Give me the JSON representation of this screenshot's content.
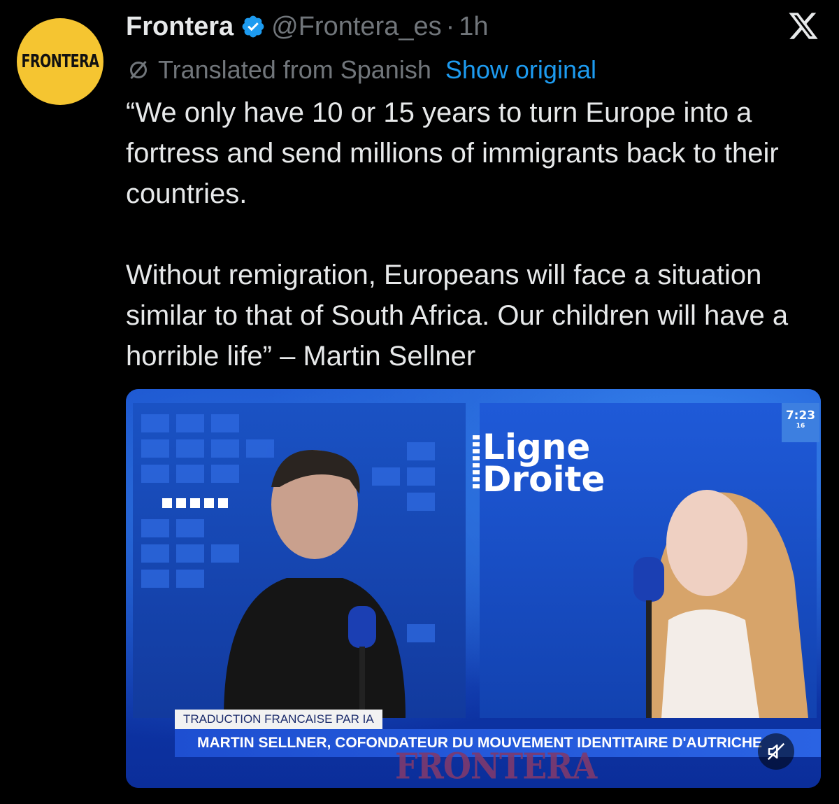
{
  "account": {
    "avatar_text": "FRONTERA",
    "avatar_color": "#f5c531",
    "name": "Frontera",
    "handle": "@Frontera_es",
    "separator": "·",
    "time": "1h",
    "verified_icon": "verified-badge-icon",
    "platform_icon": "x-logo-icon"
  },
  "translation": {
    "label": "Translated from Spanish",
    "action": "Show original",
    "icon": "translate-icon",
    "link_color": "#1d9bf0"
  },
  "tweet": {
    "paragraph1": "“We only have 10 or 15 years to turn Europe into a fortress and send millions of immigrants back to their countries.",
    "paragraph2": "Without remigration, Europeans will face a situation similar to that of South Africa. Our children will have a horrible life” – Martin Sellner"
  },
  "media": {
    "show_brand_line1": "Ligne",
    "show_brand_line2": "Droite",
    "clock_time": "7:23",
    "clock_date": "16",
    "caption_small": "TRADUCTION FRANCAISE PAR IA",
    "caption_main": "MARTIN SELLNER, COFONDATEUR DU MOUVEMENT IDENTITAIRE D'AUTRICHE",
    "watermark": "FRONTERA",
    "mute_icon": "muted-speaker-icon",
    "accent_color": "#1e4fd1"
  }
}
